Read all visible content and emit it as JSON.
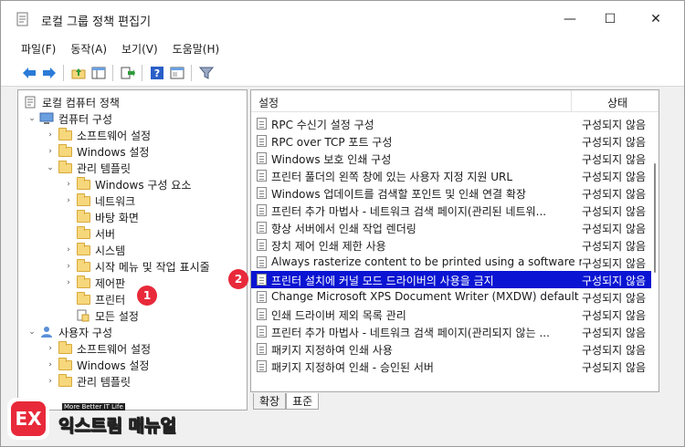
{
  "window": {
    "title": "로컬 그룹 정책 편집기",
    "controls": {
      "minimize": "—",
      "maximize": "☐",
      "close": "✕"
    }
  },
  "menu": [
    "파일(F)",
    "동작(A)",
    "보기(V)",
    "도움말(H)"
  ],
  "toolbar": {
    "icons": [
      "back-arrow-icon",
      "forward-arrow-icon",
      "folder-up-icon",
      "show-hide-tree-icon",
      "export-list-icon",
      "help-icon",
      "properties-icon",
      "filter-icon"
    ]
  },
  "tree": [
    {
      "label": "로컬 컴퓨터 정책",
      "arrow": "",
      "icon": "policy-icon"
    },
    {
      "label": "컴퓨터 구성",
      "arrow": "v",
      "icon": "computer-icon"
    },
    {
      "label": "소프트웨어 설정",
      "arrow": ">",
      "icon": "folder-icon"
    },
    {
      "label": "Windows 설정",
      "arrow": ">",
      "icon": "folder-icon"
    },
    {
      "label": "관리 템플릿",
      "arrow": "v",
      "icon": "folder-icon"
    },
    {
      "label": "Windows 구성 요소",
      "arrow": ">",
      "icon": "folder-icon"
    },
    {
      "label": "네트워크",
      "arrow": ">",
      "icon": "folder-icon"
    },
    {
      "label": "바탕 화면",
      "arrow": "",
      "icon": "folder-icon"
    },
    {
      "label": "서버",
      "arrow": "",
      "icon": "folder-icon"
    },
    {
      "label": "시스템",
      "arrow": ">",
      "icon": "folder-icon"
    },
    {
      "label": "시작 메뉴 및 작업 표시줄",
      "arrow": ">",
      "icon": "folder-icon"
    },
    {
      "label": "제어판",
      "arrow": ">",
      "icon": "folder-icon"
    },
    {
      "label": "프린터",
      "arrow": "",
      "icon": "folder-icon",
      "selected": true
    },
    {
      "label": "모든 설정",
      "arrow": "",
      "icon": "all-settings-icon"
    },
    {
      "label": "사용자 구성",
      "arrow": "v",
      "icon": "user-icon"
    },
    {
      "label": "소프트웨어 설정",
      "arrow": ">",
      "icon": "folder-icon"
    },
    {
      "label": "Windows 설정",
      "arrow": ">",
      "icon": "folder-icon"
    },
    {
      "label": "관리 템플릿",
      "arrow": ">",
      "icon": "folder-icon"
    }
  ],
  "list": {
    "header_setting": "설정",
    "header_state": "상태",
    "rows": [
      {
        "setting": "RPC 수신기 설정 구성",
        "state": "구성되지 않음"
      },
      {
        "setting": "RPC over TCP 포트 구성",
        "state": "구성되지 않음"
      },
      {
        "setting": "Windows 보호 인쇄 구성",
        "state": "구성되지 않음"
      },
      {
        "setting": "프린터 풀더의 왼쪽 창에 있는 사용자 지정 지원 URL",
        "state": "구성되지 않음"
      },
      {
        "setting": "Windows 업데이트를 검색할 포인트 및 인쇄 연결 확장",
        "state": "구성되지 않음"
      },
      {
        "setting": "프린터 추가 마법사 - 네트워크 검색 페이지(관리된 네트워...",
        "state": "구성되지 않음"
      },
      {
        "setting": "항상 서버에서 인쇄 작업 렌더링",
        "state": "구성되지 않음"
      },
      {
        "setting": "장치 제어 인쇄 제한 사용",
        "state": "구성되지 않음"
      },
      {
        "setting": "Always rasterize content to be printed using a software ras...",
        "state": "구성되지 않음"
      },
      {
        "setting": "프린터 설치에 커널 모드 드라이버의 사용을 금지",
        "state": "구성되지 않음",
        "selected": true
      },
      {
        "setting": "Change Microsoft XPS Document Writer (MXDW) default ...",
        "state": "구성되지 않음"
      },
      {
        "setting": "인쇄 드라이버 제외 목록 관리",
        "state": "구성되지 않음"
      },
      {
        "setting": "프린터 추가 마법사 - 네트워크 검색 페이지(관리되지 않는 ...",
        "state": "구성되지 않음"
      },
      {
        "setting": "패키지 지정하여 인쇄 사용",
        "state": "구성되지 않음"
      },
      {
        "setting": "패키지 지정하여 인쇄 - 승인된 서버",
        "state": "구성되지 않음"
      }
    ]
  },
  "tabs": [
    {
      "label": "확장",
      "active": false
    },
    {
      "label": "표준",
      "active": true
    }
  ],
  "annotations": [
    "1",
    "2"
  ],
  "logo": {
    "mark": "EX",
    "tagline": "More Better IT Life",
    "name": "익스트림 매뉴얼"
  },
  "colors": {
    "selection": "#0a14d2",
    "badge": "#e8293a",
    "folder": "#f6d77c"
  }
}
